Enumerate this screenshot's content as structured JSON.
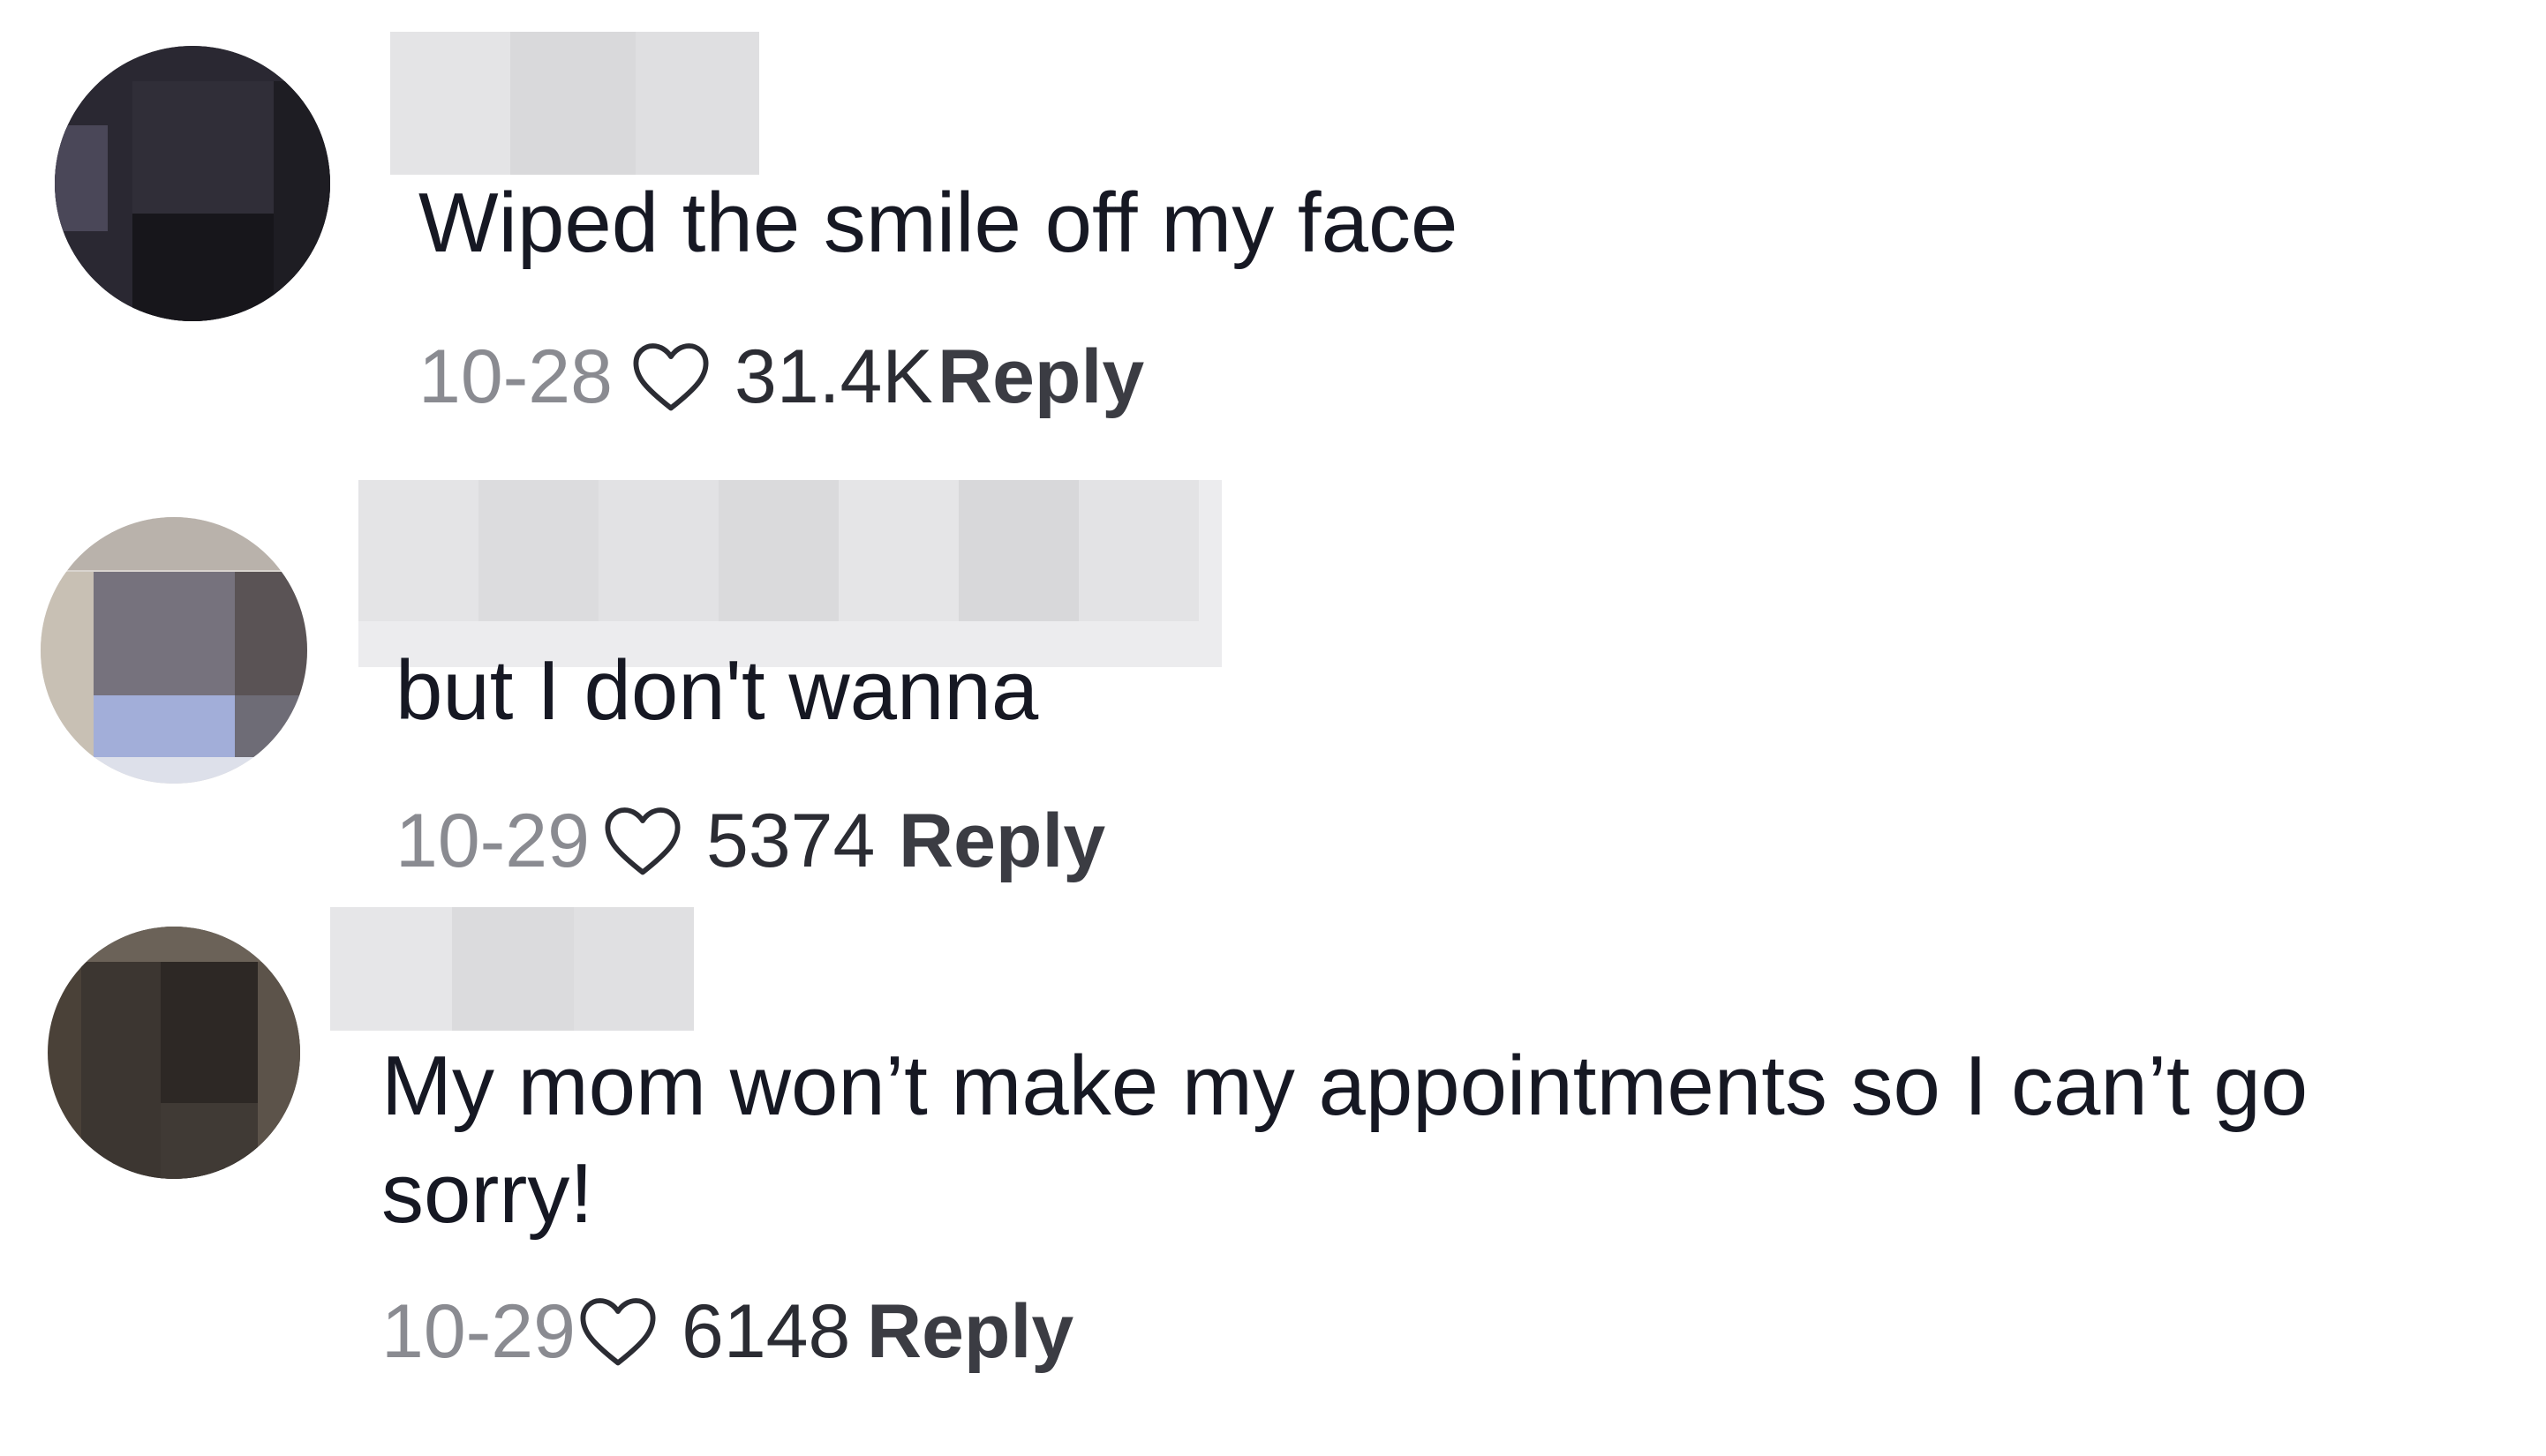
{
  "comments": [
    {
      "text": "Wiped the smile off my face",
      "date": "10-28",
      "likes": "31.4K",
      "reply_label": "Reply",
      "avatar_colors": [
        "#1b1a20",
        "#2b2a31",
        "#151419",
        "#3a3847",
        "#24232a"
      ],
      "username_blur_colors": [
        "#e6e6e8",
        "#d9d9db",
        "#dedee0"
      ]
    },
    {
      "text": "but I don't wanna",
      "date": "10-29",
      "likes": "5374",
      "reply_label": "Reply",
      "avatar_colors": [
        "#d9d4cf",
        "#77737e",
        "#5b5456",
        "#9eaad6",
        "#6f6d77"
      ],
      "username_blur_colors": [
        "#e4e4e6",
        "#dcdcde",
        "#e0e0e2",
        "#d8d8da",
        "#e6e6e8",
        "#dadadc",
        "#e2e2e4"
      ]
    },
    {
      "text": "My mom won’t make my appointments so I can’t go sorry!",
      "date": "10-29",
      "likes": "6148",
      "reply_label": "Reply",
      "avatar_colors": [
        "#4a4138",
        "#3b3530",
        "#57504a",
        "#2c2724",
        "#62594f"
      ],
      "username_blur_colors": [
        "#e4e4e6",
        "#dcdcde",
        "#e0e0e2"
      ]
    }
  ],
  "icons": {
    "like": "heart-icon"
  }
}
